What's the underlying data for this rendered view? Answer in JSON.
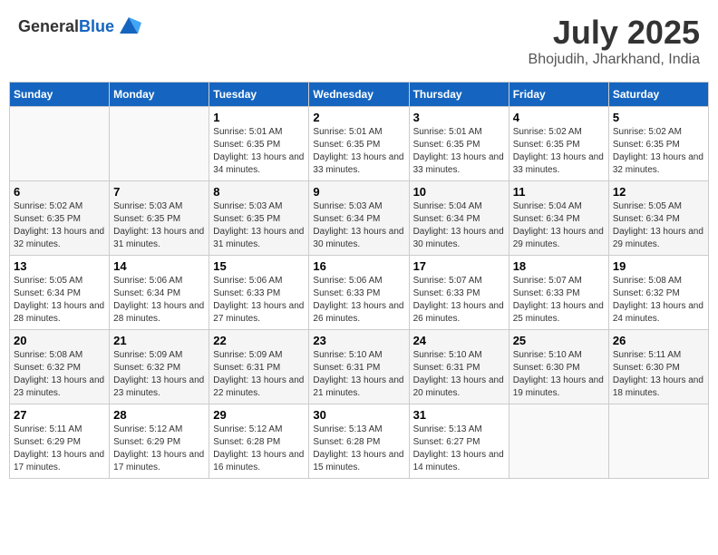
{
  "header": {
    "logo_general": "General",
    "logo_blue": "Blue",
    "month": "July 2025",
    "location": "Bhojudih, Jharkhand, India"
  },
  "days_of_week": [
    "Sunday",
    "Monday",
    "Tuesday",
    "Wednesday",
    "Thursday",
    "Friday",
    "Saturday"
  ],
  "weeks": [
    [
      {
        "day": "",
        "info": ""
      },
      {
        "day": "",
        "info": ""
      },
      {
        "day": "1",
        "sunrise": "Sunrise: 5:01 AM",
        "sunset": "Sunset: 6:35 PM",
        "daylight": "Daylight: 13 hours and 34 minutes."
      },
      {
        "day": "2",
        "sunrise": "Sunrise: 5:01 AM",
        "sunset": "Sunset: 6:35 PM",
        "daylight": "Daylight: 13 hours and 33 minutes."
      },
      {
        "day": "3",
        "sunrise": "Sunrise: 5:01 AM",
        "sunset": "Sunset: 6:35 PM",
        "daylight": "Daylight: 13 hours and 33 minutes."
      },
      {
        "day": "4",
        "sunrise": "Sunrise: 5:02 AM",
        "sunset": "Sunset: 6:35 PM",
        "daylight": "Daylight: 13 hours and 33 minutes."
      },
      {
        "day": "5",
        "sunrise": "Sunrise: 5:02 AM",
        "sunset": "Sunset: 6:35 PM",
        "daylight": "Daylight: 13 hours and 32 minutes."
      }
    ],
    [
      {
        "day": "6",
        "sunrise": "Sunrise: 5:02 AM",
        "sunset": "Sunset: 6:35 PM",
        "daylight": "Daylight: 13 hours and 32 minutes."
      },
      {
        "day": "7",
        "sunrise": "Sunrise: 5:03 AM",
        "sunset": "Sunset: 6:35 PM",
        "daylight": "Daylight: 13 hours and 31 minutes."
      },
      {
        "day": "8",
        "sunrise": "Sunrise: 5:03 AM",
        "sunset": "Sunset: 6:35 PM",
        "daylight": "Daylight: 13 hours and 31 minutes."
      },
      {
        "day": "9",
        "sunrise": "Sunrise: 5:03 AM",
        "sunset": "Sunset: 6:34 PM",
        "daylight": "Daylight: 13 hours and 30 minutes."
      },
      {
        "day": "10",
        "sunrise": "Sunrise: 5:04 AM",
        "sunset": "Sunset: 6:34 PM",
        "daylight": "Daylight: 13 hours and 30 minutes."
      },
      {
        "day": "11",
        "sunrise": "Sunrise: 5:04 AM",
        "sunset": "Sunset: 6:34 PM",
        "daylight": "Daylight: 13 hours and 29 minutes."
      },
      {
        "day": "12",
        "sunrise": "Sunrise: 5:05 AM",
        "sunset": "Sunset: 6:34 PM",
        "daylight": "Daylight: 13 hours and 29 minutes."
      }
    ],
    [
      {
        "day": "13",
        "sunrise": "Sunrise: 5:05 AM",
        "sunset": "Sunset: 6:34 PM",
        "daylight": "Daylight: 13 hours and 28 minutes."
      },
      {
        "day": "14",
        "sunrise": "Sunrise: 5:06 AM",
        "sunset": "Sunset: 6:34 PM",
        "daylight": "Daylight: 13 hours and 28 minutes."
      },
      {
        "day": "15",
        "sunrise": "Sunrise: 5:06 AM",
        "sunset": "Sunset: 6:33 PM",
        "daylight": "Daylight: 13 hours and 27 minutes."
      },
      {
        "day": "16",
        "sunrise": "Sunrise: 5:06 AM",
        "sunset": "Sunset: 6:33 PM",
        "daylight": "Daylight: 13 hours and 26 minutes."
      },
      {
        "day": "17",
        "sunrise": "Sunrise: 5:07 AM",
        "sunset": "Sunset: 6:33 PM",
        "daylight": "Daylight: 13 hours and 26 minutes."
      },
      {
        "day": "18",
        "sunrise": "Sunrise: 5:07 AM",
        "sunset": "Sunset: 6:33 PM",
        "daylight": "Daylight: 13 hours and 25 minutes."
      },
      {
        "day": "19",
        "sunrise": "Sunrise: 5:08 AM",
        "sunset": "Sunset: 6:32 PM",
        "daylight": "Daylight: 13 hours and 24 minutes."
      }
    ],
    [
      {
        "day": "20",
        "sunrise": "Sunrise: 5:08 AM",
        "sunset": "Sunset: 6:32 PM",
        "daylight": "Daylight: 13 hours and 23 minutes."
      },
      {
        "day": "21",
        "sunrise": "Sunrise: 5:09 AM",
        "sunset": "Sunset: 6:32 PM",
        "daylight": "Daylight: 13 hours and 23 minutes."
      },
      {
        "day": "22",
        "sunrise": "Sunrise: 5:09 AM",
        "sunset": "Sunset: 6:31 PM",
        "daylight": "Daylight: 13 hours and 22 minutes."
      },
      {
        "day": "23",
        "sunrise": "Sunrise: 5:10 AM",
        "sunset": "Sunset: 6:31 PM",
        "daylight": "Daylight: 13 hours and 21 minutes."
      },
      {
        "day": "24",
        "sunrise": "Sunrise: 5:10 AM",
        "sunset": "Sunset: 6:31 PM",
        "daylight": "Daylight: 13 hours and 20 minutes."
      },
      {
        "day": "25",
        "sunrise": "Sunrise: 5:10 AM",
        "sunset": "Sunset: 6:30 PM",
        "daylight": "Daylight: 13 hours and 19 minutes."
      },
      {
        "day": "26",
        "sunrise": "Sunrise: 5:11 AM",
        "sunset": "Sunset: 6:30 PM",
        "daylight": "Daylight: 13 hours and 18 minutes."
      }
    ],
    [
      {
        "day": "27",
        "sunrise": "Sunrise: 5:11 AM",
        "sunset": "Sunset: 6:29 PM",
        "daylight": "Daylight: 13 hours and 17 minutes."
      },
      {
        "day": "28",
        "sunrise": "Sunrise: 5:12 AM",
        "sunset": "Sunset: 6:29 PM",
        "daylight": "Daylight: 13 hours and 17 minutes."
      },
      {
        "day": "29",
        "sunrise": "Sunrise: 5:12 AM",
        "sunset": "Sunset: 6:28 PM",
        "daylight": "Daylight: 13 hours and 16 minutes."
      },
      {
        "day": "30",
        "sunrise": "Sunrise: 5:13 AM",
        "sunset": "Sunset: 6:28 PM",
        "daylight": "Daylight: 13 hours and 15 minutes."
      },
      {
        "day": "31",
        "sunrise": "Sunrise: 5:13 AM",
        "sunset": "Sunset: 6:27 PM",
        "daylight": "Daylight: 13 hours and 14 minutes."
      },
      {
        "day": "",
        "info": ""
      },
      {
        "day": "",
        "info": ""
      }
    ]
  ]
}
